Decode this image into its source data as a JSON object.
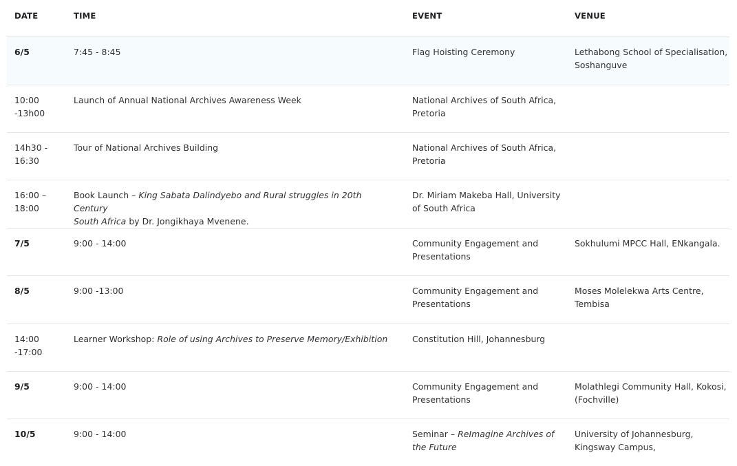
{
  "header": {
    "date": "DATE",
    "time": "TIME",
    "event": "EVENT",
    "venue": "VENUE"
  },
  "rows": [
    {
      "date": "6/5",
      "time": "7:45 - 8:45",
      "event": "Flag Hoisting Ceremony",
      "venue": "Lethabong School of Specialisation,\nSoshanguve"
    },
    {
      "date": "10:00\n-13h00",
      "time": "Launch of Annual National Archives Awareness Week",
      "event": "National Archives of South Africa,\nPretoria",
      "venue": ""
    },
    {
      "date": "14h30 -\n16:30",
      "time": "Tour of National Archives Building",
      "event": "National Archives of South Africa,\nPretoria",
      "venue": ""
    },
    {
      "date": "16:00 –\n18:00",
      "time_prefix": "Book Launch – ",
      "time_italic_1": "King Sabata Dalindyebo and Rural struggles in 20th Century",
      "time_italic_2": "South Africa",
      "time_suffix": " by Dr. Jongikhaya Mvenene.",
      "event": "Dr. Miriam Makeba Hall, University\nof South Africa",
      "venue": ""
    },
    {
      "date": "7/5",
      "time": "9:00 - 14:00",
      "event": "Community Engagement and\nPresentations",
      "venue": "Sokhulumi MPCC Hall, ENkangala."
    },
    {
      "date": "8/5",
      "time": "9:00 -13:00",
      "event": "Community Engagement and\nPresentations",
      "venue": "Moses Molelekwa Arts Centre,\nTembisa"
    },
    {
      "date": "14:00\n-17:00",
      "time_prefix": "Learner Workshop: ",
      "time_italic": "Role of using Archives to Preserve Memory/Exhibition",
      "event": "Constitution Hill, Johannesburg",
      "venue": ""
    },
    {
      "date": "9/5",
      "time": "9:00 - 14:00",
      "event": "Community Engagement and\nPresentations",
      "venue": "Molathlegi Community Hall, Kokosi,\n(Fochville)"
    },
    {
      "date": "10/5",
      "time": "9:00 - 14:00",
      "event_prefix": "Seminar – ",
      "event_italic_1": "ReImagine Archives of",
      "event_italic_2": "the Future",
      "venue": "University of Johannesburg,\nKingsway Campus,"
    }
  ]
}
